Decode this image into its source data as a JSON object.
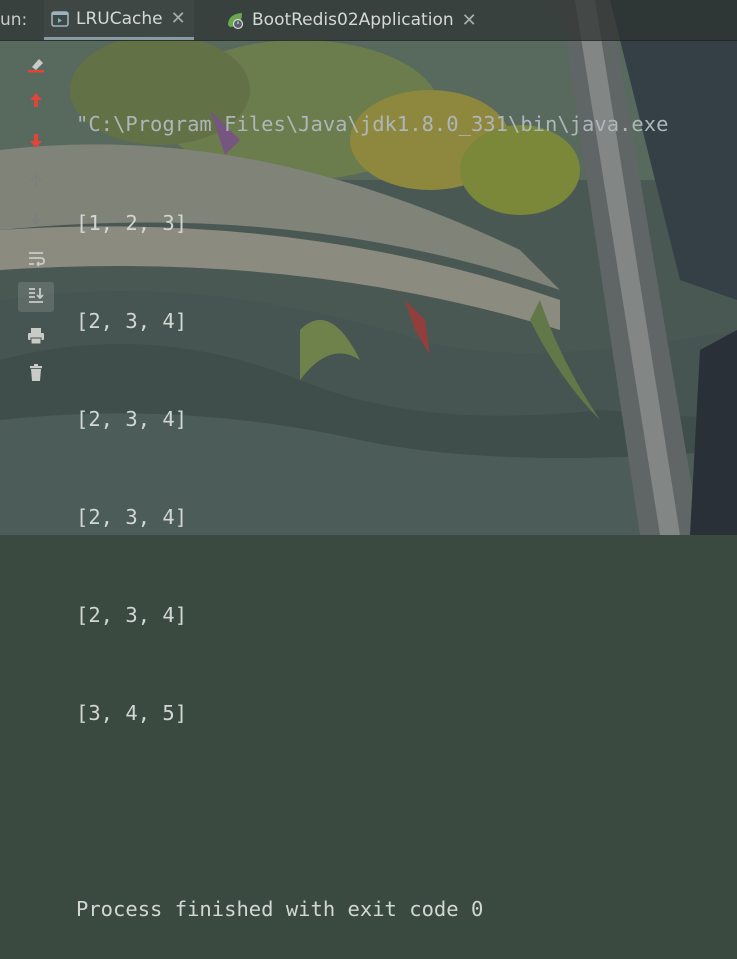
{
  "run_panel": {
    "label": "un:",
    "tabs": [
      {
        "label": "LRUCache",
        "icon": "application-icon",
        "active": true
      },
      {
        "label": "BootRedis02Application",
        "icon": "spring-boot-icon",
        "active": false
      }
    ]
  },
  "toolbar": {
    "buttons": [
      {
        "name": "clear-all-icon"
      },
      {
        "name": "previous-occurrence-icon"
      },
      {
        "name": "next-occurrence-icon"
      },
      {
        "name": "scroll-up-icon"
      },
      {
        "name": "scroll-down-icon"
      },
      {
        "name": "soft-wrap-icon"
      },
      {
        "name": "scroll-to-end-icon"
      },
      {
        "name": "print-icon"
      },
      {
        "name": "delete-icon"
      }
    ]
  },
  "console": {
    "command": "\"C:\\Program Files\\Java\\jdk1.8.0_331\\bin\\java.exe",
    "lines": [
      "[1, 2, 3]",
      "[2, 3, 4]",
      "[2, 3, 4]",
      "[2, 3, 4]",
      "[2, 3, 4]",
      "[3, 4, 5]"
    ],
    "exit_message": "Process finished with exit code 0"
  },
  "colors": {
    "console_text": "#d3d7d3",
    "accent_red": "#e0453b"
  }
}
